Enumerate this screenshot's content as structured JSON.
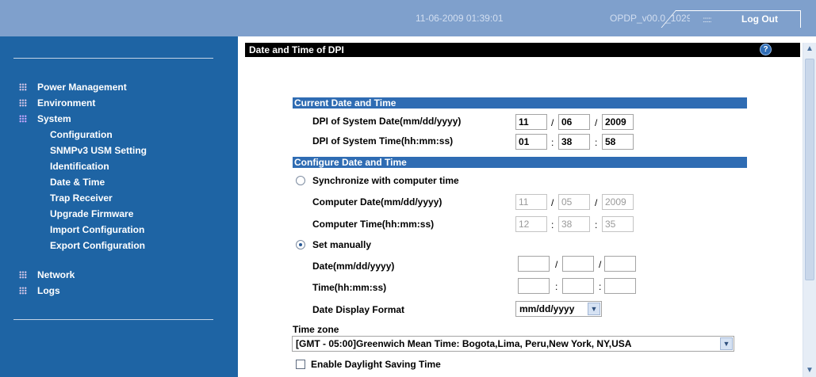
{
  "header": {
    "datetime": "11-06-2009 01:39:01",
    "version": "OPDP_v00.0_1029",
    "logout_label": "Log Out",
    "logout_dots": "::::::"
  },
  "sidebar": {
    "items": [
      {
        "label": "Power Management"
      },
      {
        "label": "Environment"
      },
      {
        "label": "System"
      },
      {
        "label": "Network"
      },
      {
        "label": "Logs"
      }
    ],
    "sub_items": [
      {
        "label": "Configuration"
      },
      {
        "label": "SNMPv3 USM Setting"
      },
      {
        "label": "Identification"
      },
      {
        "label": "Date & Time"
      },
      {
        "label": "Trap Receiver"
      },
      {
        "label": "Upgrade Firmware"
      },
      {
        "label": "Import Configuration"
      },
      {
        "label": "Export Configuration"
      }
    ]
  },
  "main": {
    "title": "Date and Time of DPI",
    "help_glyph": "?",
    "current": {
      "header": "Current Date and Time",
      "date_label": "DPI of System Date(mm/dd/yyyy)",
      "date": [
        "11",
        "06",
        "2009"
      ],
      "time_label": "DPI of System Time(hh:mm:ss)",
      "time": [
        "01",
        "38",
        "58"
      ]
    },
    "configure": {
      "header": "Configure Date and Time",
      "sync_label": "Synchronize with computer time",
      "computer_date_label": "Computer Date(mm/dd/yyyy)",
      "computer_date": [
        "11",
        "05",
        "2009"
      ],
      "computer_time_label": "Computer Time(hh:mm:ss)",
      "computer_time": [
        "12",
        "38",
        "35"
      ],
      "manual_label": "Set manually",
      "date_label": "Date(mm/dd/yyyy)",
      "time_label": "Time(hh:mm:ss)",
      "format_label": "Date Display Format",
      "format_value": "mm/dd/yyyy",
      "timezone_label": "Time zone",
      "timezone_value": "[GMT - 05:00]Greenwich Mean Time: Bogota,Lima, Peru,New York, NY,USA",
      "dst_label": "Enable Daylight Saving Time"
    },
    "separators": {
      "date": "/",
      "time": ":"
    }
  },
  "colors": {
    "header_bg": "#7fa0cc",
    "sidebar_bg": "#1e64a4",
    "section_header_bg": "#2f6cb3",
    "title_bar_bg": "#000000"
  },
  "icons": {
    "nav_bullet": "dots-grid-icon",
    "help": "help-icon",
    "dropdown": "chevron-down-icon"
  }
}
